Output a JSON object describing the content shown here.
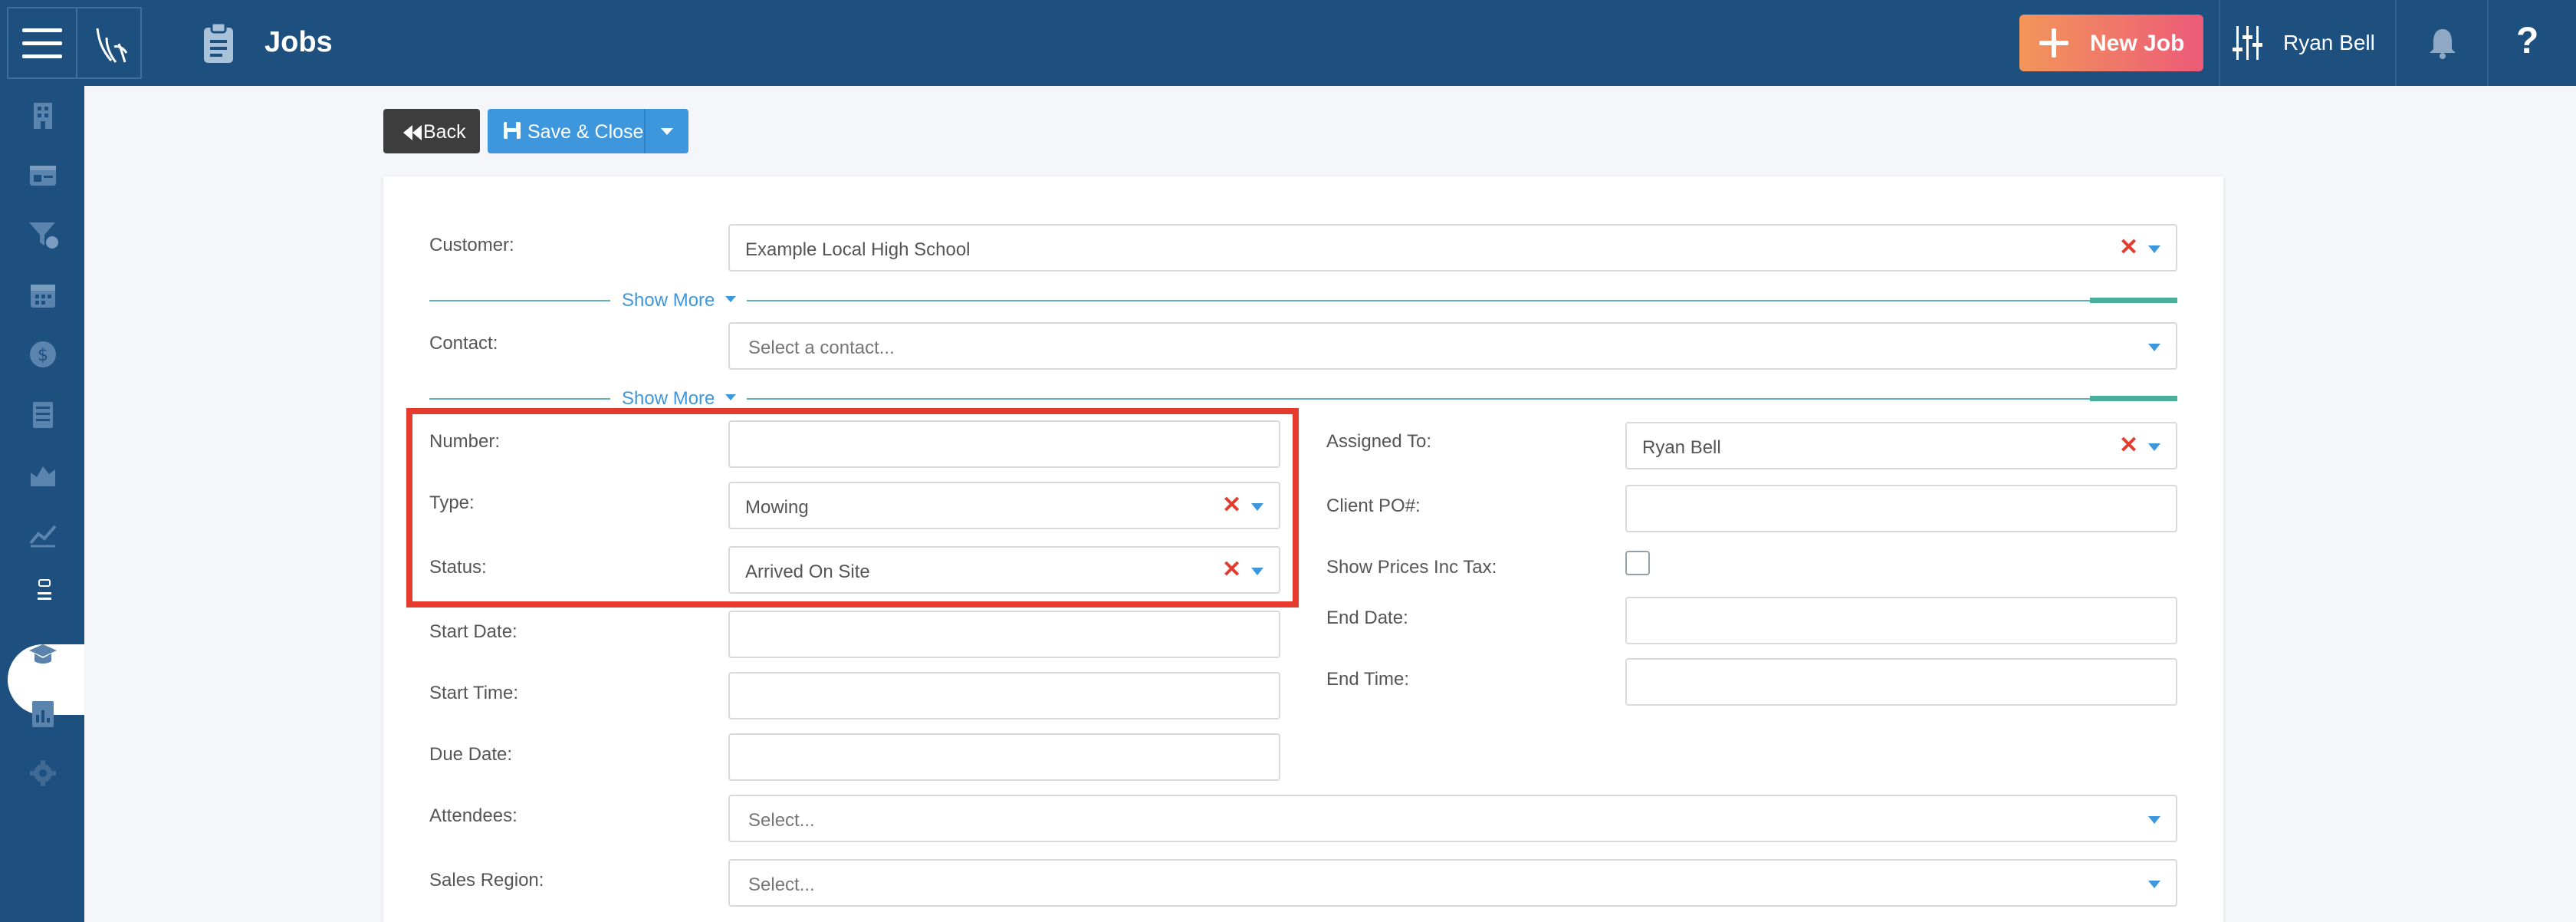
{
  "header": {
    "page_title": "Jobs",
    "new_job_label": "New Job",
    "user_name": "Ryan Bell",
    "help_label": "?"
  },
  "toolbar": {
    "back_label": "Back",
    "save_close_label": "Save & Close"
  },
  "form": {
    "customer": {
      "label": "Customer:",
      "value": "Example Local High School"
    },
    "show_more_1": "Show More",
    "contact": {
      "label": "Contact:",
      "placeholder": "Select a contact..."
    },
    "show_more_2": "Show More",
    "number": {
      "label": "Number:",
      "value": ""
    },
    "type": {
      "label": "Type:",
      "value": "Mowing"
    },
    "status": {
      "label": "Status:",
      "value": "Arrived On Site"
    },
    "start_date": {
      "label": "Start Date:",
      "value": ""
    },
    "start_time": {
      "label": "Start Time:",
      "value": ""
    },
    "due_date": {
      "label": "Due Date:",
      "value": ""
    },
    "assigned_to": {
      "label": "Assigned To:",
      "value": "Ryan Bell"
    },
    "client_po": {
      "label": "Client PO#:",
      "value": ""
    },
    "show_prices_inc_tax": {
      "label": "Show Prices Inc Tax:",
      "checked": false
    },
    "end_date": {
      "label": "End Date:",
      "value": ""
    },
    "end_time": {
      "label": "End Time:",
      "value": ""
    },
    "attendees": {
      "label": "Attendees:",
      "placeholder": "Select..."
    },
    "sales_region": {
      "label": "Sales Region:",
      "placeholder": "Select..."
    }
  },
  "colors": {
    "brand_navy": "#1d4f7f",
    "accent_blue": "#3e97dc",
    "clear_red": "#e53b2c",
    "highlight_red": "#e53b2c"
  },
  "sidebar_icons": [
    "building-icon",
    "id-card-icon",
    "filter-dollar-icon",
    "calendar-icon",
    "dollar-icon",
    "list-icon",
    "chart-area-icon",
    "trend-icon",
    "clipboard-icon",
    "graduation-cap-icon",
    "report-icon",
    "gear-icon"
  ]
}
